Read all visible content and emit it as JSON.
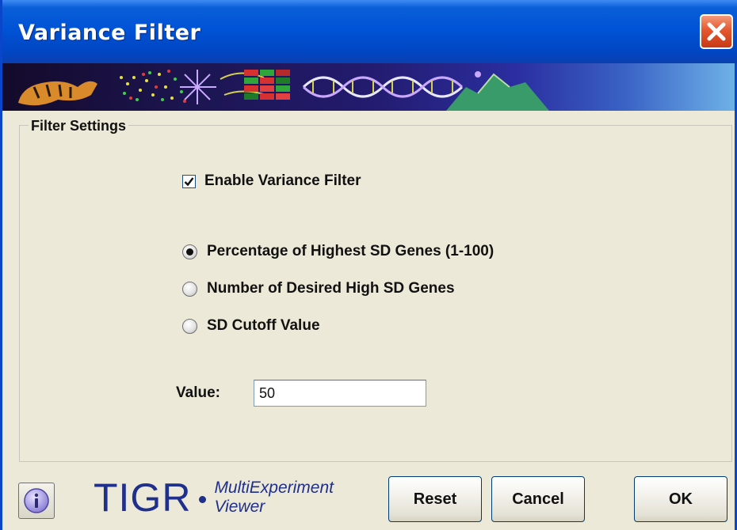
{
  "window": {
    "title": "Variance Filter"
  },
  "filter_settings": {
    "group_label": "Filter Settings",
    "enable_checkbox": {
      "label": "Enable Variance Filter",
      "checked": true
    },
    "radio_options": [
      {
        "label": "Percentage of Highest SD Genes (1-100)",
        "selected": true
      },
      {
        "label": "Number of Desired High SD Genes",
        "selected": false
      },
      {
        "label": "SD Cutoff Value",
        "selected": false
      }
    ],
    "value_label": "Value:",
    "value": "50"
  },
  "footer": {
    "logo_main": "TIGR",
    "logo_sub_line1": "MultiExperiment",
    "logo_sub_line2": "Viewer",
    "buttons": {
      "reset": "Reset",
      "cancel": "Cancel",
      "ok": "OK"
    }
  },
  "icons": {
    "close": "close-icon",
    "info": "info-icon",
    "checkmark": "checkmark-icon",
    "banner": "tigr-banner-image"
  },
  "colors": {
    "titlebar": "#0053d6",
    "close_button": "#e4572f",
    "logo": "#1f2f8c",
    "panel": "#ece9d8"
  }
}
